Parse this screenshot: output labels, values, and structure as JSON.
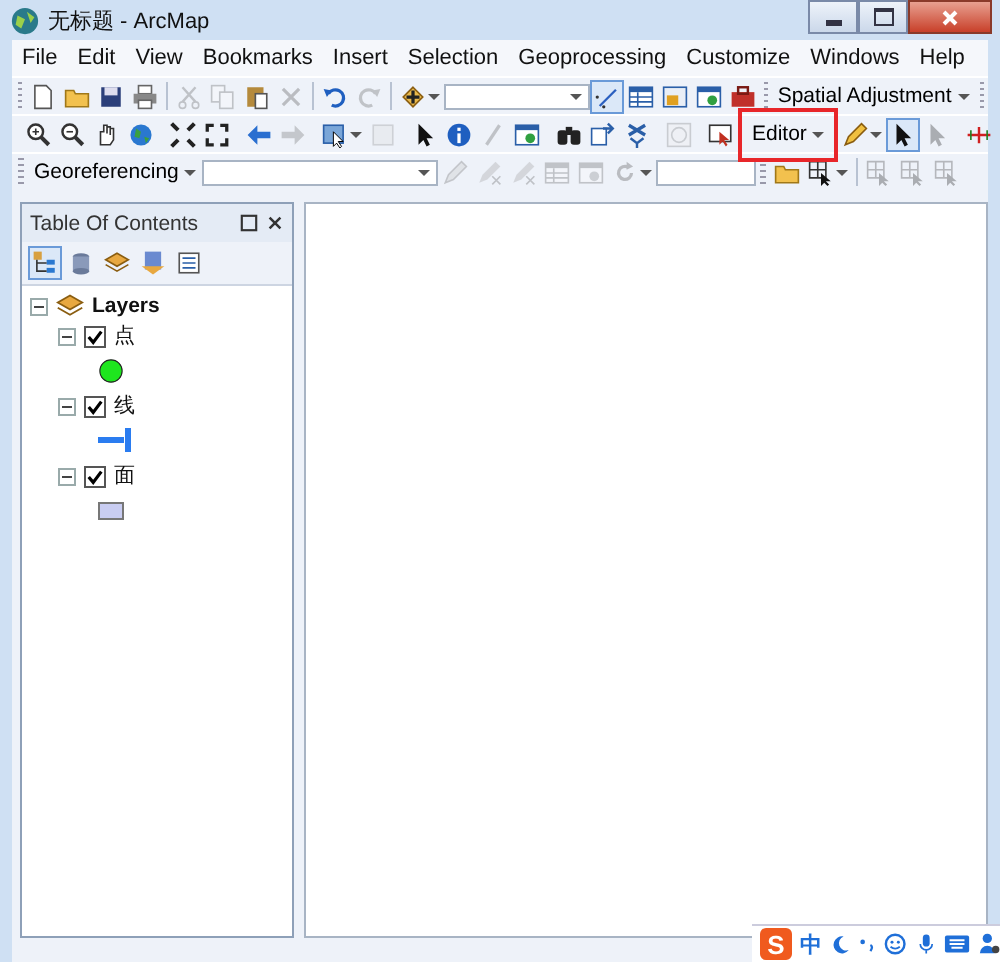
{
  "window": {
    "title": "无标题 - ArcMap"
  },
  "menu": [
    "File",
    "Edit",
    "View",
    "Bookmarks",
    "Insert",
    "Selection",
    "Geoprocessing",
    "Customize",
    "Windows",
    "Help"
  ],
  "toolbar_rows": [
    [
      {
        "kind": "grip"
      },
      {
        "kind": "button",
        "disabled": false,
        "selected": false
      },
      {
        "kind": "button",
        "disabled": false,
        "selected": false
      },
      {
        "kind": "button",
        "disabled": false,
        "selected": false
      },
      {
        "kind": "button",
        "disabled": false,
        "selected": false
      },
      {
        "kind": "sep"
      },
      {
        "kind": "button",
        "disabled": true,
        "selected": false
      },
      {
        "kind": "button",
        "disabled": true,
        "selected": false
      },
      {
        "kind": "button",
        "disabled": false,
        "selected": false
      },
      {
        "kind": "button",
        "disabled": true,
        "selected": false
      },
      {
        "kind": "sep"
      },
      {
        "kind": "button",
        "disabled": false,
        "selected": false
      },
      {
        "kind": "button",
        "disabled": true,
        "selected": false
      },
      {
        "kind": "sep"
      },
      {
        "kind": "button",
        "disabled": false,
        "selected": false
      },
      {
        "kind": "combo"
      },
      {
        "kind": "button",
        "disabled": false,
        "selected": true
      },
      {
        "kind": "button",
        "disabled": false,
        "selected": false
      },
      {
        "kind": "button",
        "disabled": false,
        "selected": false
      },
      {
        "kind": "button",
        "disabled": false,
        "selected": false
      },
      {
        "kind": "button",
        "disabled": false,
        "selected": false
      },
      {
        "kind": "grip"
      },
      {
        "kind": "menu",
        "label": "Spatial Adjustment"
      },
      {
        "kind": "grip"
      }
    ],
    [
      {
        "kind": "grip"
      },
      {
        "kind": "button",
        "disabled": false,
        "selected": false
      },
      {
        "kind": "button",
        "disabled": false,
        "selected": false
      },
      {
        "kind": "button",
        "disabled": false,
        "selected": false
      },
      {
        "kind": "button",
        "disabled": false,
        "selected": false
      },
      {
        "kind": "sep"
      },
      {
        "kind": "button",
        "disabled": false,
        "selected": false
      },
      {
        "kind": "button",
        "disabled": false,
        "selected": false
      },
      {
        "kind": "sep"
      },
      {
        "kind": "button",
        "disabled": false,
        "selected": false
      },
      {
        "kind": "button",
        "disabled": true,
        "selected": false
      },
      {
        "kind": "sep"
      },
      {
        "kind": "button",
        "disabled": false,
        "selected": false
      },
      {
        "kind": "button",
        "disabled": true,
        "selected": false
      },
      {
        "kind": "sep"
      },
      {
        "kind": "button",
        "disabled": false,
        "selected": false
      },
      {
        "kind": "button",
        "disabled": false,
        "selected": false
      },
      {
        "kind": "button",
        "disabled": true,
        "selected": false
      },
      {
        "kind": "button",
        "disabled": false,
        "selected": false
      },
      {
        "kind": "sep"
      },
      {
        "kind": "button",
        "disabled": false,
        "selected": false
      },
      {
        "kind": "button",
        "disabled": false,
        "selected": false
      },
      {
        "kind": "button",
        "disabled": false,
        "selected": false
      },
      {
        "kind": "sep"
      },
      {
        "kind": "button",
        "disabled": true,
        "selected": false
      },
      {
        "kind": "sep"
      },
      {
        "kind": "button",
        "disabled": false,
        "selected": false
      },
      {
        "kind": "grip"
      },
      {
        "kind": "menu",
        "label": "Editor",
        "highlighted": true
      },
      {
        "kind": "sep"
      },
      {
        "kind": "button",
        "disabled": false,
        "selected": false
      },
      {
        "kind": "button",
        "disabled": false,
        "selected": true
      },
      {
        "kind": "button",
        "disabled": true,
        "selected": false
      },
      {
        "kind": "grip"
      },
      {
        "kind": "button",
        "disabled": false,
        "selected": false
      },
      {
        "kind": "grip"
      }
    ],
    [
      {
        "kind": "grip"
      },
      {
        "kind": "menu",
        "label": "Georeferencing"
      },
      {
        "kind": "combo"
      },
      {
        "kind": "button",
        "disabled": true,
        "selected": false
      },
      {
        "kind": "button",
        "disabled": true,
        "selected": false
      },
      {
        "kind": "button",
        "disabled": true,
        "selected": false
      },
      {
        "kind": "button",
        "disabled": true,
        "selected": false
      },
      {
        "kind": "button",
        "disabled": true,
        "selected": false
      },
      {
        "kind": "button",
        "disabled": true,
        "selected": false
      },
      {
        "kind": "field"
      },
      {
        "kind": "grip"
      },
      {
        "kind": "button",
        "disabled": false,
        "selected": false
      },
      {
        "kind": "button",
        "disabled": false,
        "selected": false
      },
      {
        "kind": "sep"
      },
      {
        "kind": "button",
        "disabled": true,
        "selected": false
      },
      {
        "kind": "button",
        "disabled": true,
        "selected": false
      },
      {
        "kind": "button",
        "disabled": true,
        "selected": false
      }
    ]
  ],
  "toc": {
    "title": "Table Of Contents",
    "tools": [
      {
        "selected": true
      },
      {
        "selected": false
      },
      {
        "selected": false
      },
      {
        "selected": false
      },
      {
        "selected": false
      }
    ],
    "root": {
      "label": "Layers",
      "expanded": true,
      "children": [
        {
          "label": "点",
          "checked": true,
          "expanded": true,
          "kind": "point",
          "color": "#1ee61e"
        },
        {
          "label": "线",
          "checked": true,
          "expanded": true,
          "kind": "line",
          "color": "#2a7cf0"
        },
        {
          "label": "面",
          "checked": true,
          "expanded": true,
          "kind": "polygon",
          "color": "#c9cdf2"
        }
      ]
    }
  },
  "ime": {
    "logo": "S",
    "mode": "中"
  }
}
